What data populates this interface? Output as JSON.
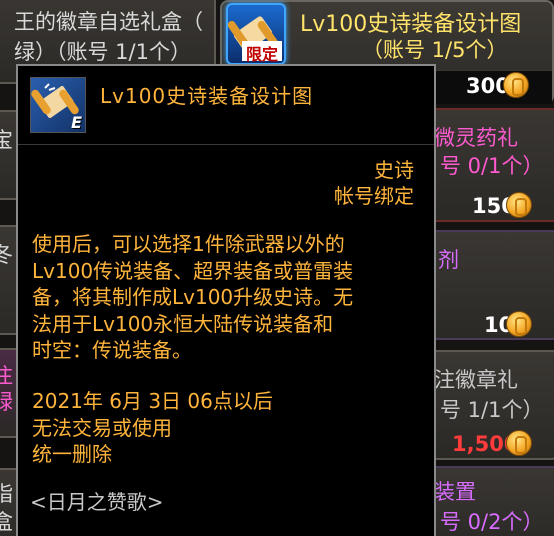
{
  "background": {
    "top_left_item": {
      "line1": "王的徽章自选礼盒（",
      "line2": "绿）（账号 1/1个）"
    },
    "featured_item": {
      "title": "Lv100史诗装备设计图",
      "limit": "（账号 1/5个）",
      "price": "300",
      "badge": "限定"
    },
    "right_items": [
      {
        "line1": "微灵药礼",
        "line2": "号 0/1个）",
        "price": "150"
      },
      {
        "line1": "剂",
        "line2": "",
        "price": "10"
      },
      {
        "line1": "注徽章礼",
        "line2": "号 1/1个）",
        "price": "1,500"
      },
      {
        "line1": "装置",
        "line2": "号 0/2个）",
        "price": ""
      }
    ],
    "left_fragments": [
      "宝",
      "冬"
    ],
    "left_pink_fragments": [
      "注",
      "绿"
    ],
    "bottom_left_fragments": [
      "指",
      "盒"
    ]
  },
  "tooltip": {
    "title": "Lv100史诗装备设计图",
    "rarity": "史诗",
    "bind": "帐号绑定",
    "description": "使用后，可以选择1件除武器以外的\nLv100传说装备、超界装备或普雷装\n备，将其制作成Lv100升级史诗。无\n法用于Lv100永恒大陆传说装备和\n时空：传说装备。",
    "expire_line1": "2021年 6月 3日 06点以后",
    "expire_line2": "无法交易或使用",
    "expire_line3": "统一删除",
    "set_name": "<日月之赞歌>",
    "icon_letter": "E"
  },
  "colors": {
    "tooltip_text": "#ffb43c",
    "featured_title": "#ffe36a",
    "price_red": "#ff3c3c",
    "pink_text": "#ff5ad0"
  }
}
